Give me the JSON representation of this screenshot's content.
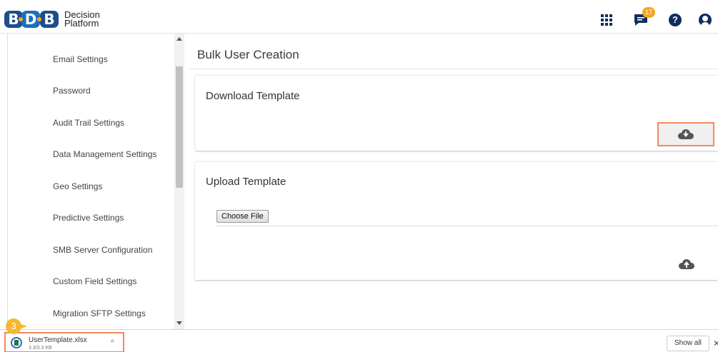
{
  "header": {
    "brand_line1": "Decision",
    "brand_line2": "Platform",
    "notification_count": "17",
    "help_glyph": "?"
  },
  "sidebar": {
    "items": [
      {
        "label": "Email Settings"
      },
      {
        "label": "Password"
      },
      {
        "label": "Audit Trail Settings"
      },
      {
        "label": "Data Management Settings"
      },
      {
        "label": "Geo Settings"
      },
      {
        "label": "Predictive Settings"
      },
      {
        "label": "SMB Server Configuration"
      },
      {
        "label": "Custom Field Settings"
      },
      {
        "label": "Migration SFTP Settings"
      }
    ]
  },
  "main": {
    "title": "Bulk User Creation",
    "download_section": {
      "title": "Download Template"
    },
    "upload_section": {
      "title": "Upload Template",
      "choose_file_label": "Choose File"
    }
  },
  "download_bar": {
    "file_name": "UserTemplate.xlsx",
    "file_size": "3.3/3.3 KB",
    "show_all_label": "Show all",
    "close_glyph": "✕"
  },
  "annotation": {
    "step": "3",
    "highlight_color": "#f08a5d",
    "badge_color": "#f5b82e"
  },
  "colors": {
    "brand_navy": "#0f2d5c",
    "badge_orange": "#f5a623"
  },
  "icons": [
    "apps-grid-icon",
    "chat-icon",
    "help-icon",
    "user-icon",
    "cloud-download-icon",
    "cloud-upload-icon",
    "excel-file-icon",
    "chevron-up-icon",
    "close-icon"
  ]
}
